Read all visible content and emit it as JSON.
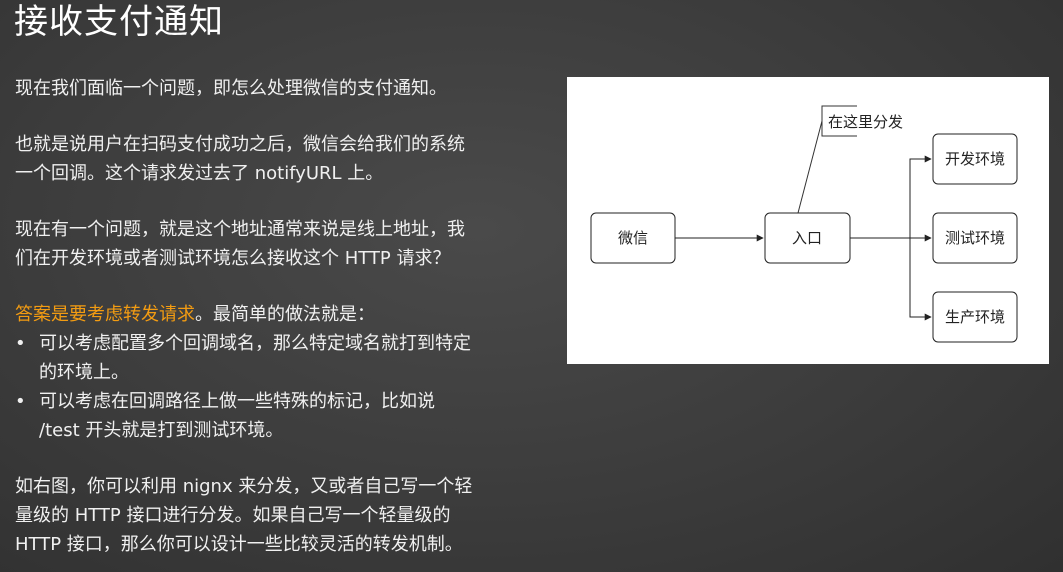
{
  "slide": {
    "title": "接收支付通知",
    "paragraphs": {
      "p1": "现在我们面临一个问题，即怎么处理微信的支付通知。",
      "p2_line1": "也就是说用户在扫码支付成功之后，微信会给我们的系统",
      "p2_line2": "一个回调。这个请求发过去了 notifyURL 上。",
      "p3_line1": "现在有一个问题，就是这个地址通常来说是线上地址，我",
      "p3_line2": "们在开发环境或者测试环境怎么接收这个 HTTP 请求？",
      "p4_highlight": "答案是要考虑转发请求",
      "p4_rest": "。最简单的做法就是：",
      "p5_line1": "如右图，你可以利用 nignx 来分发，又或者自己写一个轻",
      "p5_line2": "量级的 HTTP 接口进行分发。如果自己写一个轻量级的",
      "p5_line3": "HTTP 接口，那么你可以设计一些比较灵活的转发机制。"
    },
    "bullets": [
      {
        "marker": "•",
        "line1": "可以考虑配置多个回调域名，那么特定域名就打到特定",
        "line2": "的环境上。"
      },
      {
        "marker": "•",
        "line1": "可以考虑在回调路径上做一些特殊的标记，比如说",
        "line2": "/test 开头就是打到测试环境。"
      }
    ],
    "colors": {
      "highlight": "#f39c12",
      "background": "#3c3c3c"
    }
  },
  "diagram": {
    "nodes": {
      "wechat": "微信",
      "entry": "入口",
      "dev": "开发环境",
      "test": "测试环境",
      "prod": "生产环境"
    },
    "annotation": "在这里分发"
  }
}
